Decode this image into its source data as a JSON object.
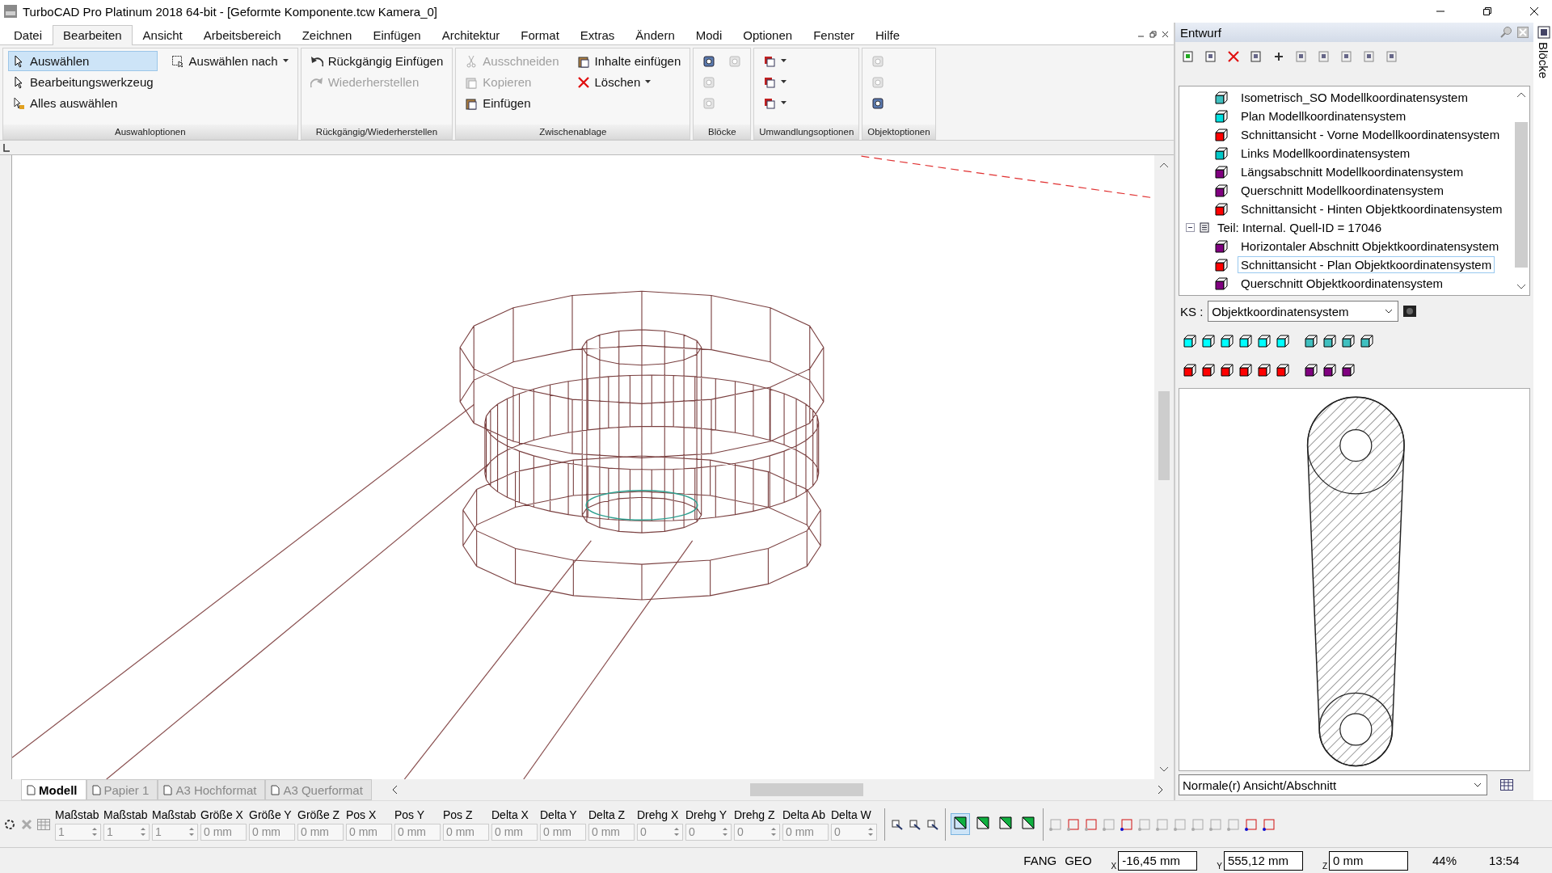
{
  "window": {
    "title": "TurboCAD Pro Platinum 2018 64-bit - [Geformte Komponente.tcw Kamera_0]"
  },
  "menu": {
    "tabs": [
      {
        "label": "Datei",
        "selected": false
      },
      {
        "label": "Bearbeiten",
        "selected": true
      },
      {
        "label": "Ansicht",
        "selected": false
      },
      {
        "label": "Arbeitsbereich",
        "selected": false
      },
      {
        "label": "Zeichnen",
        "selected": false
      },
      {
        "label": "Einfügen",
        "selected": false
      },
      {
        "label": "Architektur",
        "selected": false
      },
      {
        "label": "Format",
        "selected": false
      },
      {
        "label": "Extras",
        "selected": false
      },
      {
        "label": "Ändern",
        "selected": false
      },
      {
        "label": "Modi",
        "selected": false
      },
      {
        "label": "Optionen",
        "selected": false
      },
      {
        "label": "Fenster",
        "selected": false
      },
      {
        "label": "Hilfe",
        "selected": false
      }
    ]
  },
  "ribbon": {
    "groups": [
      {
        "label": "Auswahloptionen",
        "items": [
          {
            "label": "Auswählen",
            "kind": "pointer",
            "selected": true
          },
          {
            "label": "Bearbeitungswerkzeug",
            "kind": "edit",
            "selected": false
          },
          {
            "label": "Alles auswählen",
            "kind": "selectall",
            "selected": false
          },
          {
            "label": "Auswählen nach",
            "kind": "selectby",
            "selected": false,
            "dropdown": true
          }
        ]
      },
      {
        "label": "Rückgängig/Wiederherstellen",
        "items": [
          {
            "label": "Rückgängig Einfügen",
            "kind": "undo",
            "disabled": false
          },
          {
            "label": "Wiederherstellen",
            "kind": "redo",
            "disabled": true
          }
        ]
      },
      {
        "label": "Zwischenablage",
        "items": [
          {
            "label": "Ausschneiden",
            "kind": "cut",
            "disabled": true
          },
          {
            "label": "Kopieren",
            "kind": "copy",
            "disabled": true
          },
          {
            "label": "Einfügen",
            "kind": "paste",
            "disabled": false
          },
          {
            "label": "Inhalte einfügen",
            "kind": "paste",
            "disabled": false
          },
          {
            "label": "Löschen",
            "kind": "delete",
            "disabled": false,
            "dropdown": true
          }
        ]
      },
      {
        "label": "Blöcke",
        "items": [
          {
            "kind": "block",
            "disabled": false
          },
          {
            "kind": "block",
            "disabled": true
          },
          {
            "kind": "block",
            "disabled": true
          },
          {
            "kind": "block",
            "disabled": true
          }
        ]
      },
      {
        "label": "Umwandlungsoptionen",
        "items": [
          {
            "kind": "transform",
            "disabled": false,
            "dropdown": true
          },
          {
            "kind": "transform",
            "disabled": false,
            "dropdown": true
          },
          {
            "kind": "transform",
            "disabled": false,
            "dropdown": true
          }
        ]
      },
      {
        "label": "Objektoptionen",
        "items": [
          {
            "kind": "object",
            "disabled": true
          },
          {
            "kind": "object",
            "disabled": true
          },
          {
            "kind": "object",
            "disabled": false
          }
        ]
      }
    ]
  },
  "sheets": [
    {
      "label": "Modell",
      "selected": true
    },
    {
      "label": "Papier 1",
      "selected": false
    },
    {
      "label": "A3 Hochformat",
      "selected": false
    },
    {
      "label": "A3 Querformat",
      "selected": false
    }
  ],
  "panel": {
    "title": "Entwurf",
    "side_tab": "Blöcke",
    "tree": {
      "nodes": [
        {
          "children": [
            {
              "label": "Isometrisch_SO Modellkoordinatensystem",
              "color": "#40c0c0",
              "selected": false
            },
            {
              "label": "Plan Modellkoordinatensystem",
              "color": "#00e0e0",
              "selected": false
            },
            {
              "label": "Schnittansicht - Vorne Modellkoordinatensystem",
              "color": "#ff0000",
              "selected": false
            },
            {
              "label": "Links Modellkoordinatensystem",
              "color": "#00c8c8",
              "selected": false
            },
            {
              "label": "Längsabschnitt Modellkoordinatensystem",
              "color": "#800080",
              "selected": false
            },
            {
              "label": "Querschnitt Modellkoordinatensystem",
              "color": "#800080",
              "selected": false
            },
            {
              "label": "Schnittansicht - Hinten Objektkoordinatensystem",
              "color": "#ff0000",
              "selected": false
            }
          ]
        },
        {
          "label": "Teil: Internal. Quell-ID = 17046",
          "expanded": true,
          "children": [
            {
              "label": "Horizontaler Abschnitt Objektkoordinatensystem",
              "color": "#800080",
              "selected": false
            },
            {
              "label": "Schnittansicht - Plan Objektkoordinatensystem",
              "color": "#ff0000",
              "selected": true
            },
            {
              "label": "Querschnitt Objektkoordinatensystem",
              "color": "#800080",
              "selected": false
            }
          ]
        }
      ]
    },
    "ks_label": "KS :",
    "ks_value": "Objektkoordinatensystem",
    "view_buttons": [
      [
        {
          "color": "#00ffff"
        },
        {
          "color": "#00ffff"
        },
        {
          "color": "#00ffff"
        },
        {
          "color": "#00ffff"
        },
        {
          "color": "#00ffff"
        },
        {
          "color": "#00ffff"
        },
        {
          "color": "#40c0c0"
        },
        {
          "color": "#40c0c0"
        },
        {
          "color": "#40c0c0"
        },
        {
          "color": "#40c0c0"
        }
      ],
      [
        {
          "color": "#ff0000"
        },
        {
          "color": "#ff0000"
        },
        {
          "color": "#ff0000"
        },
        {
          "color": "#ff0000"
        },
        {
          "color": "#ff0000"
        },
        {
          "color": "#ff0000"
        },
        {
          "color": "#800080"
        },
        {
          "color": "#800080"
        },
        {
          "color": "#800080"
        }
      ]
    ],
    "view_value": "Normale(r) Ansicht/Abschnitt"
  },
  "properties": [
    {
      "label": "Maßstab",
      "value": "1",
      "kind": "spin",
      "disabled": true
    },
    {
      "label": "Maßstab",
      "value": "1",
      "kind": "spin",
      "disabled": true
    },
    {
      "label": "Maßstab",
      "value": "1",
      "kind": "spin",
      "disabled": true
    },
    {
      "label": "Größe X",
      "value": "0 mm",
      "kind": "text",
      "disabled": true
    },
    {
      "label": "Größe Y",
      "value": "0 mm",
      "kind": "text",
      "disabled": true
    },
    {
      "label": "Größe Z",
      "value": "0 mm",
      "kind": "text",
      "disabled": true
    },
    {
      "label": "Pos X",
      "value": "0 mm",
      "kind": "text",
      "disabled": true
    },
    {
      "label": "Pos Y",
      "value": "0 mm",
      "kind": "text",
      "disabled": true
    },
    {
      "label": "Pos Z",
      "value": "0 mm",
      "kind": "text",
      "disabled": true
    },
    {
      "label": "Delta X",
      "value": "0 mm",
      "kind": "text",
      "disabled": true
    },
    {
      "label": "Delta Y",
      "value": "0 mm",
      "kind": "text",
      "disabled": true
    },
    {
      "label": "Delta Z",
      "value": "0 mm",
      "kind": "text",
      "disabled": true
    },
    {
      "label": "Drehg X",
      "value": "0",
      "kind": "spin",
      "disabled": true
    },
    {
      "label": "Drehg Y",
      "value": "0",
      "kind": "spin",
      "disabled": true
    },
    {
      "label": "Drehg Z",
      "value": "0",
      "kind": "spin",
      "disabled": true
    },
    {
      "label": "Delta Ab",
      "value": "0 mm",
      "kind": "text",
      "disabled": true
    },
    {
      "label": "Delta W",
      "value": "0",
      "kind": "spin",
      "disabled": true
    }
  ],
  "mode_buttons": [
    {
      "selected": true
    },
    {
      "selected": false
    },
    {
      "selected": false
    },
    {
      "selected": false
    }
  ],
  "status": {
    "snap": "FANG",
    "geo": "GEO",
    "coords": [
      {
        "axis": "X",
        "value": "-16,45 mm"
      },
      {
        "axis": "Y",
        "value": "555,12 mm"
      },
      {
        "axis": "Z",
        "value": "0 mm"
      }
    ],
    "zoom": "44%",
    "time": "13:54"
  }
}
